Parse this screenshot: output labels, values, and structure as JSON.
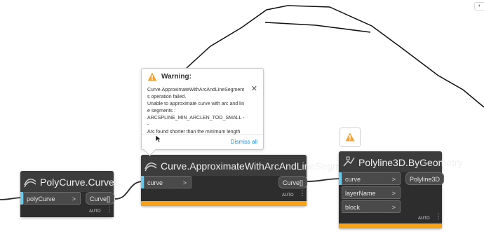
{
  "nodes": {
    "polycurve_curves": {
      "title": "PolyCurve.Curves",
      "input_label": "polyCurve",
      "input_chevron": ">",
      "output_label": "Curve[]",
      "lacing": "AUTO"
    },
    "approximate": {
      "title": "Curve.ApproximateWithArcAndLineSegments",
      "input_label": "curve",
      "input_chevron": ">",
      "output_label": "Curve[]",
      "lacing": "AUTO"
    },
    "polyline3d": {
      "title": "Polyline3D.ByGeometry",
      "inputs": [
        {
          "label": "curve",
          "chevron": ">"
        },
        {
          "label": "layerName",
          "chevron": ">"
        },
        {
          "label": "block",
          "chevron": ">"
        }
      ],
      "output_label": "Polyline3D",
      "lacing": "AUTO"
    }
  },
  "warning_popup": {
    "title": "Warning:",
    "message": "Curve.ApproximateWithArcAndLineSegments operation failed.\nUnable to approximate curve with arc and line segments :\nARCSPLINE_MIN_ARCLEN_TOO_SMALL --\nArc found shorter than the minimum length",
    "close_glyph": "✕",
    "dismiss_label": "Dismiss all"
  },
  "kebab_glyph": "⋮",
  "colors": {
    "node_header": "#3c3c3c",
    "node_body": "#2d2d2d",
    "warning_bar": "#f7a21b",
    "warning_icon": "#f2a33a",
    "port_marker": "#6bc6e8",
    "link": "#1a8cd8"
  }
}
